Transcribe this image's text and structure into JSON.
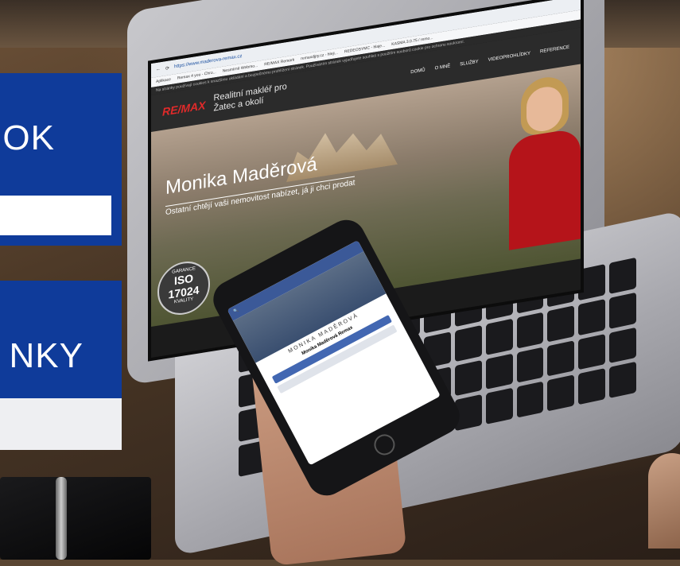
{
  "browser": {
    "url": "https://www.maderova-remax.cz",
    "bookmarks": [
      "Aplikace",
      "Remax 4 you - Chro...",
      "Nesmírně Webmo...",
      "RE/MAX Remark",
      "remaxdjpy.cz - hleji...",
      "REDEOSYMC - hlaje...",
      "KASMA 3.0.75 / remo..."
    ],
    "cookie_notice": "Na stránky používají cookies k snazšímu ukládání a bezpečnému prohlížení stránek. Používáním stránek vyjadřujete souhlas s použitím souborů cookie pro ochranu soukromí."
  },
  "site": {
    "brand": "RE/MAX",
    "tagline": "Realitní makléř pro Žatec a okolí",
    "nav": [
      "DOMŮ",
      "O MNĚ",
      "SLUŽBY",
      "VIDEOPROHLÍDKY",
      "REFERENCE"
    ],
    "hero_name": "Monika Maděrová",
    "hero_subtitle": "Ostatní chtějí vaši nemovitost nabízet, já ji chci prodat",
    "badge_top": "GARANCE",
    "badge_number": "ISO 17024",
    "badge_bottom": "KVALITY"
  },
  "phone": {
    "cover_title": "MONIKA MADĚROVÁ",
    "page_name": "Monika Maděrová Remax"
  },
  "overlays": {
    "panel1_text": "OK",
    "panel2_text": "NKY"
  }
}
